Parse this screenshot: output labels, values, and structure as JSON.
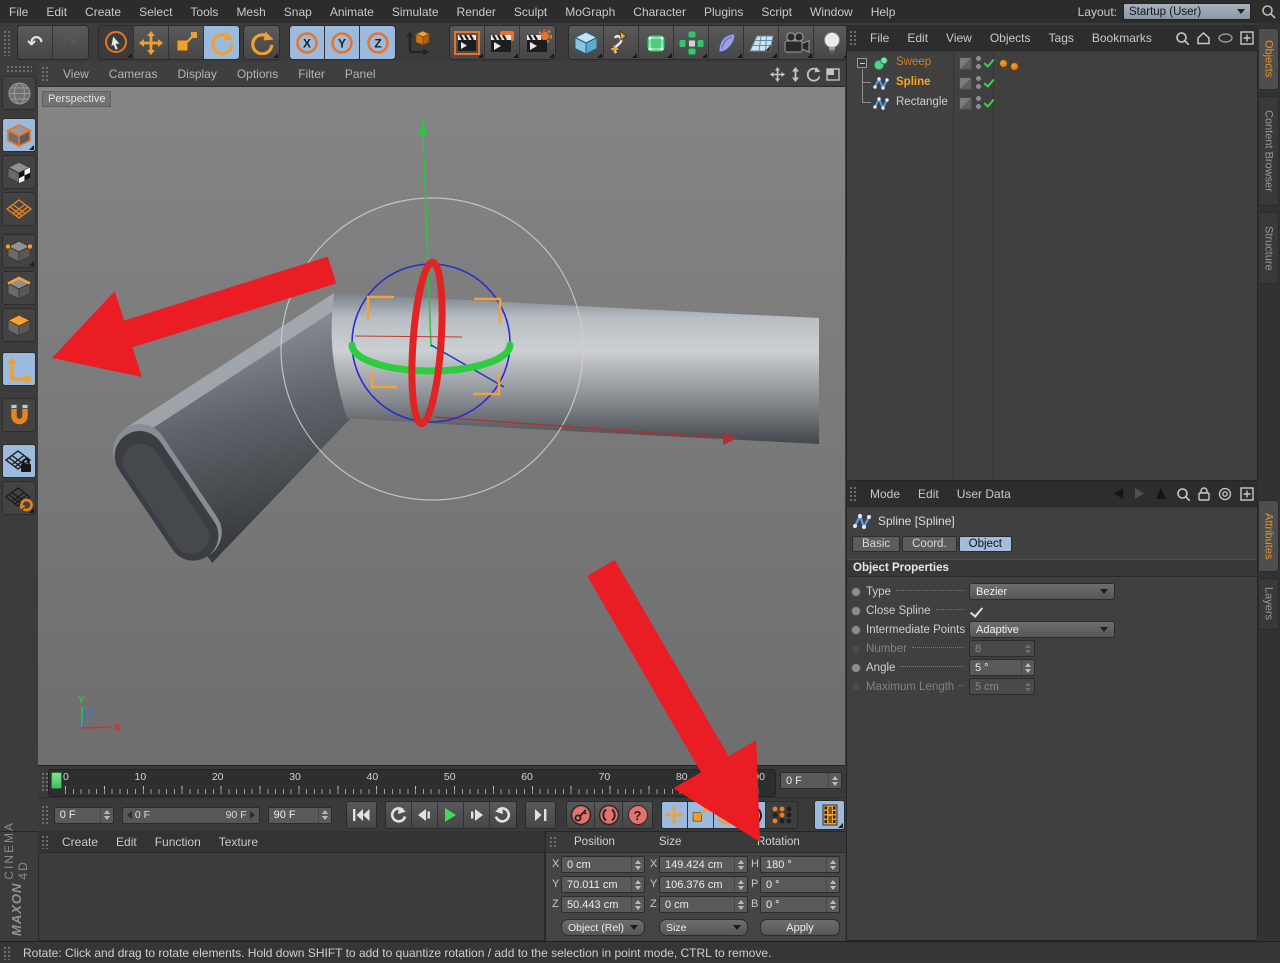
{
  "menu_bar": {
    "items": [
      "File",
      "Edit",
      "Create",
      "Select",
      "Tools",
      "Mesh",
      "Snap",
      "Animate",
      "Simulate",
      "Render",
      "Sculpt",
      "MoGraph",
      "Character",
      "Plugins",
      "Script",
      "Window",
      "Help"
    ],
    "layout_label": "Layout:",
    "layout_value": "Startup (User)"
  },
  "toolbar": {
    "axis_lock": [
      "X",
      "Y",
      "Z"
    ]
  },
  "viewport": {
    "menus": [
      "View",
      "Cameras",
      "Display",
      "Options",
      "Filter",
      "Panel"
    ],
    "view_label": "Perspective",
    "axis_x": "X",
    "axis_y": "Y",
    "axis_z": "Z"
  },
  "object_manager": {
    "menus": [
      "File",
      "Edit",
      "View",
      "Objects",
      "Tags",
      "Bookmarks"
    ],
    "objects": [
      "Sweep",
      "Spline",
      "Rectangle"
    ]
  },
  "right_tabs": {
    "objects": "Objects",
    "content_browser": "Content Browser",
    "structure": "Structure",
    "attributes": "Attributes",
    "layers": "Layers"
  },
  "attribute_manager": {
    "menus": [
      "Mode",
      "Edit",
      "User Data"
    ],
    "object_title": "Spline [Spline]",
    "tabs": [
      "Basic",
      "Coord.",
      "Object"
    ],
    "section": "Object Properties",
    "rows": [
      {
        "label": "Type",
        "value": "Bezier"
      },
      {
        "label": "Close Spline",
        "value": ""
      },
      {
        "label": "Intermediate Points",
        "value": "Adaptive"
      },
      {
        "label": "Number",
        "value": "8"
      },
      {
        "label": "Angle",
        "value": "5 °"
      },
      {
        "label": "Maximum Length",
        "value": "5 cm"
      }
    ]
  },
  "timeline": {
    "ticks": [
      "0",
      "10",
      "20",
      "30",
      "40",
      "50",
      "60",
      "70",
      "80",
      "90"
    ],
    "current_frame": "0 F"
  },
  "transport": {
    "frame_start": "0 F",
    "range_start": "0 F",
    "range_end": "90 F",
    "frame_end": "90 F",
    "param_key_label": "P",
    "help_glyph": "?"
  },
  "coordinates": {
    "headers": [
      "Position",
      "Size",
      "Rotation"
    ],
    "position": [
      {
        "axis": "X",
        "value": "0 cm"
      },
      {
        "axis": "Y",
        "value": "70.011 cm"
      },
      {
        "axis": "Z",
        "value": "50.443 cm"
      }
    ],
    "size": [
      {
        "axis": "X",
        "value": "149.424 cm"
      },
      {
        "axis": "Y",
        "value": "106.376 cm"
      },
      {
        "axis": "Z",
        "value": "0 cm"
      }
    ],
    "rotation": [
      {
        "axis": "H",
        "value": "180 °"
      },
      {
        "axis": "P",
        "value": "0 °"
      },
      {
        "axis": "B",
        "value": "0 °"
      }
    ],
    "mode": "Object (Rel)",
    "size_mode": "Size",
    "apply": "Apply"
  },
  "material_manager": {
    "menus": [
      "Create",
      "Edit",
      "Function",
      "Texture"
    ]
  },
  "logo": {
    "brand": "MAXON",
    "product": "CINEMA 4D"
  },
  "status_bar": {
    "text": "Rotate: Click and drag to rotate elements. Hold down SHIFT to add to quantize rotation / add to the selection in point mode, CTRL to remove."
  },
  "colors": {
    "accent_orange": "#e8821a",
    "active_blue": "#9cbade",
    "annotation_red": "#ea1c24",
    "axis_green": "#2fc340",
    "axis_red": "#c03030",
    "axis_blue": "#3b6de0",
    "selected_green": "#3fd04a"
  }
}
